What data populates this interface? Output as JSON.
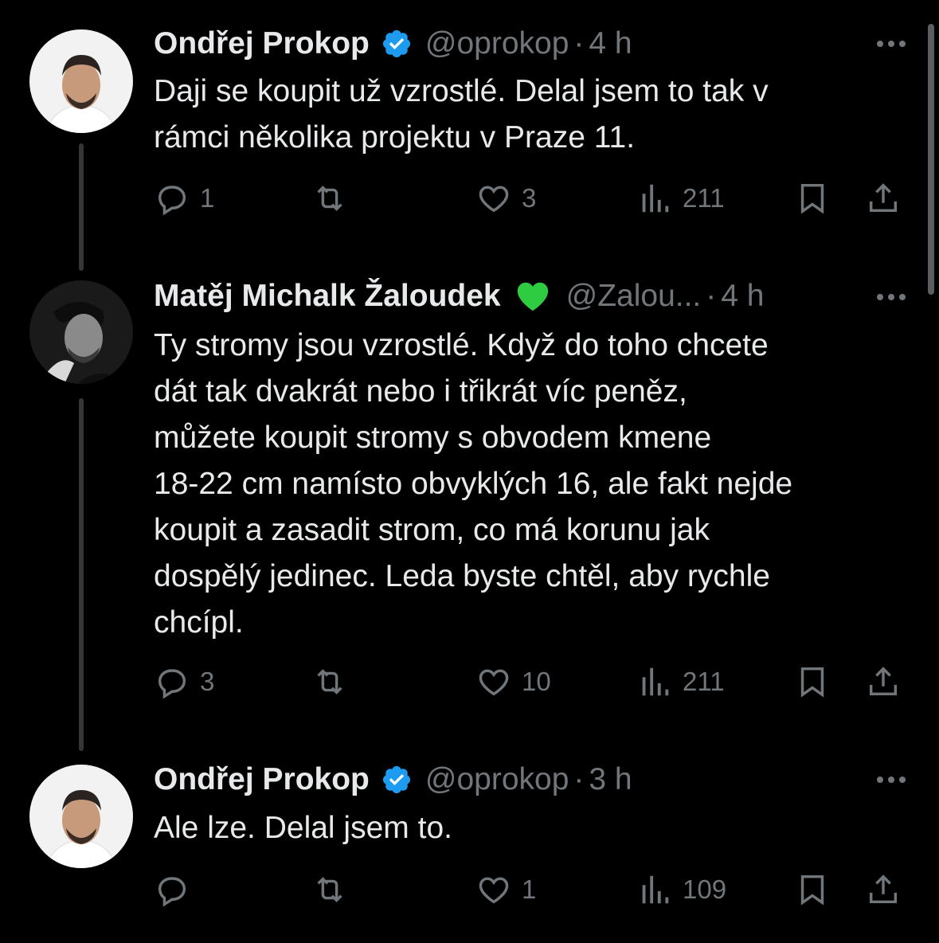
{
  "tweets": [
    {
      "name": "Ondřej Prokop",
      "handle": "@oprokop",
      "time": "4 h",
      "verified": true,
      "text_lines": [
        "Daji se koupit už vzrostlé. Delal jsem to tak v",
        "rámci několika projektu v Praze 11."
      ],
      "replies": "1",
      "reposts": "",
      "likes": "3",
      "views": "211"
    },
    {
      "name": "Matěj Michalk Žaloudek",
      "emoji": "💚",
      "handle": "@Zalou...",
      "time": "4 h",
      "verified": false,
      "text_lines": [
        "Ty stromy jsou vzrostlé. Když do toho chcete",
        "dát tak dvakrát nebo i třikrát víc peněz,",
        "můžete koupit stromy s obvodem kmene",
        "18-22 cm namísto obvyklých 16, ale fakt nejde",
        "koupit a zasadit strom, co má korunu jak",
        "dospělý jedinec. Leda byste chtěl, aby rychle",
        "chcípl."
      ],
      "replies": "3",
      "reposts": "",
      "likes": "10",
      "views": "211"
    },
    {
      "name": "Ondřej Prokop",
      "handle": "@oprokop",
      "time": "3 h",
      "verified": true,
      "text_lines": [
        "Ale lze. Delal jsem to."
      ],
      "replies": "",
      "reposts": "",
      "likes": "1",
      "views": "109"
    }
  ],
  "colors": {
    "background": "#000000",
    "text": "#e7e9ea",
    "muted": "#71767b",
    "verified": "#1d9bf0",
    "thread_line": "#333639"
  },
  "icons": [
    "reply-icon",
    "repost-icon",
    "like-icon",
    "views-icon",
    "bookmark-icon",
    "share-icon",
    "more-icon",
    "verified-badge-icon"
  ]
}
